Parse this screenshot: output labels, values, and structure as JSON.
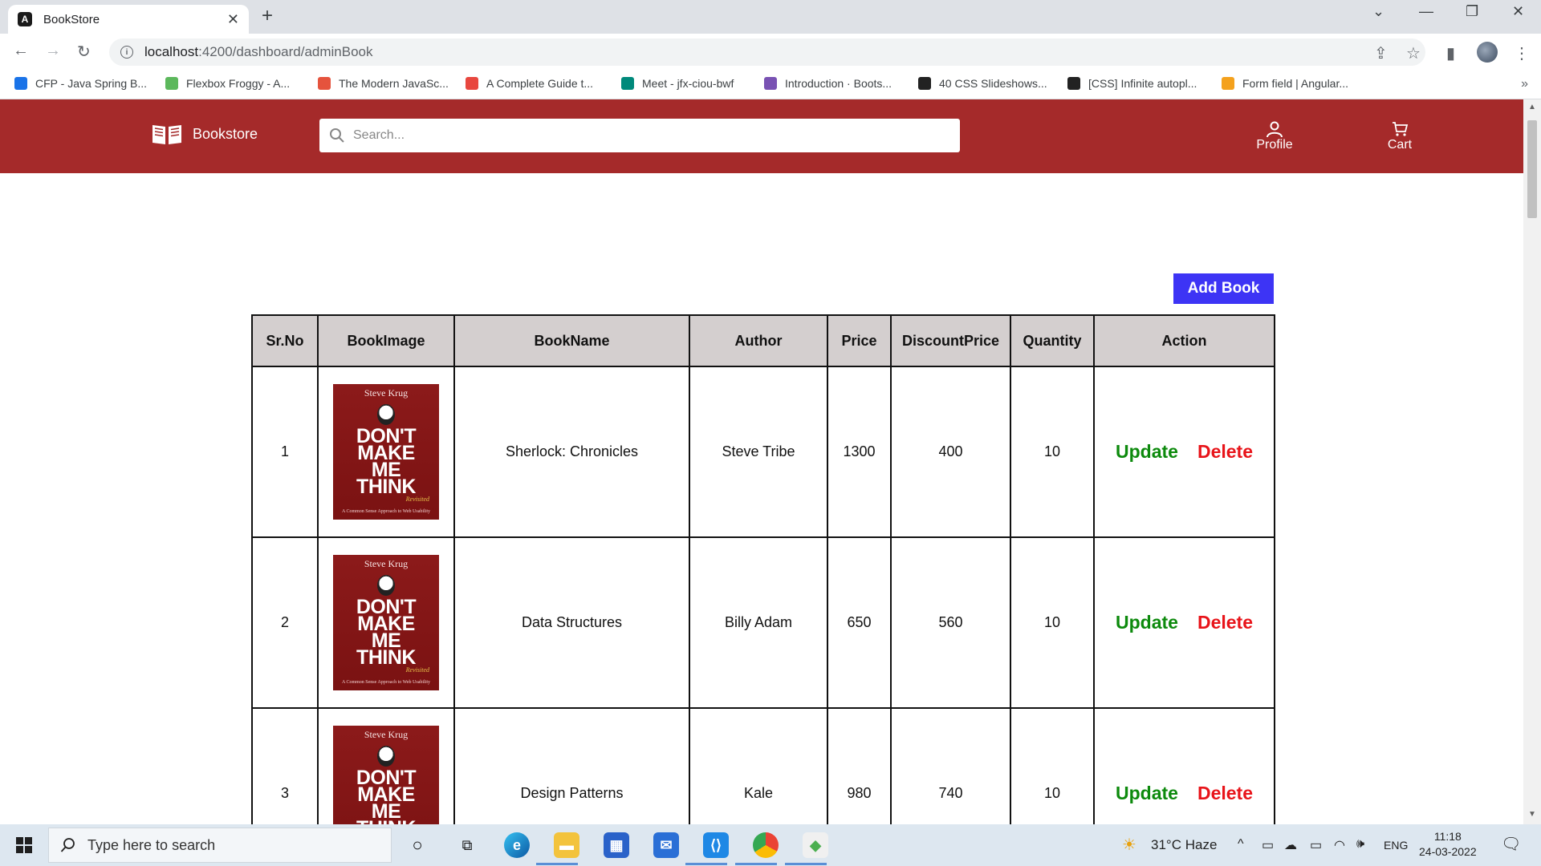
{
  "browser": {
    "tab_title": "BookStore",
    "url_host": "localhost",
    "url_path": ":4200/dashboard/adminBook",
    "bookmarks": [
      {
        "label": "CFP - Java Spring B...",
        "icon": "user-card-icon",
        "color": "#1a73e8"
      },
      {
        "label": "Flexbox Froggy - A...",
        "icon": "frog-icon",
        "color": "#5cb85c"
      },
      {
        "label": "The Modern JavaSc...",
        "icon": "runner-icon",
        "color": "#e5533d"
      },
      {
        "label": "A Complete Guide t...",
        "icon": "asterisk-icon",
        "color": "#e8473f"
      },
      {
        "label": "Meet - jfx-ciou-bwf",
        "icon": "meet-icon",
        "color": "#00897b"
      },
      {
        "label": "Introduction · Boots...",
        "icon": "bootstrap-icon",
        "color": "#7952b3"
      },
      {
        "label": "40 CSS Slideshows...",
        "icon": "circle-logo-icon",
        "color": "#222222"
      },
      {
        "label": "[CSS] Infinite autopl...",
        "icon": "codepen-icon",
        "color": "#222222"
      },
      {
        "label": "Form field | Angular...",
        "icon": "shield-icon",
        "color": "#f4a11d"
      }
    ]
  },
  "app": {
    "brand": "Bookstore",
    "search_placeholder": "Search...",
    "profile_label": "Profile",
    "cart_label": "Cart",
    "add_book_label": "Add Book",
    "colors": {
      "header": "#a52a2a",
      "add_button": "#3d34f5",
      "update": "#0d8a0d",
      "delete": "#e8141a"
    }
  },
  "table": {
    "headers": [
      "Sr.No",
      "BookImage",
      "BookName",
      "Author",
      "Price",
      "DiscountPrice",
      "Quantity",
      "Action"
    ],
    "cover": {
      "author": "Steve Krug",
      "title_lines": [
        "DON'T",
        "MAKE",
        "ME",
        "THINK"
      ],
      "subtitle": "Revisited",
      "footer": "A Common Sense Approach to Web Usability"
    },
    "rows": [
      {
        "sr": "1",
        "name": "Sherlock: Chronicles",
        "author": "Steve Tribe",
        "price": "1300",
        "discount": "400",
        "qty": "10"
      },
      {
        "sr": "2",
        "name": "Data Structures",
        "author": "Billy Adam",
        "price": "650",
        "discount": "560",
        "qty": "10"
      },
      {
        "sr": "3",
        "name": "Design Patterns",
        "author": "Kale",
        "price": "980",
        "discount": "740",
        "qty": "10"
      }
    ],
    "update_label": "Update",
    "delete_label": "Delete"
  },
  "taskbar": {
    "search_placeholder": "Type here to search",
    "weather": "31°C  Haze",
    "language": "ENG",
    "time": "11:18",
    "date": "24-03-2022"
  }
}
